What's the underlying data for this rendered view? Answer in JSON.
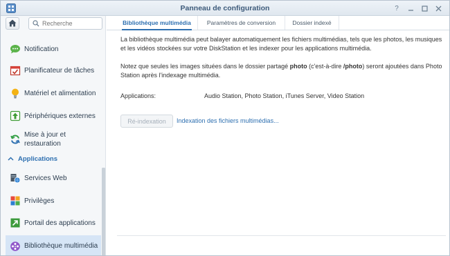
{
  "window": {
    "title": "Panneau de configuration"
  },
  "search": {
    "placeholder": "Recherche"
  },
  "sidebar": {
    "items": [
      {
        "label": "Notification"
      },
      {
        "label": "Planificateur de tâches"
      },
      {
        "label": "Matériel et alimentation"
      },
      {
        "label": "Périphériques externes"
      },
      {
        "label": "Mise à jour et restauration"
      },
      {
        "label": "Services Web"
      },
      {
        "label": "Privilèges"
      },
      {
        "label": "Portail des applications"
      },
      {
        "label": "Bibliothèque multimédia"
      }
    ],
    "section_label": "Applications",
    "active_item": "Bibliothèque multimédia"
  },
  "tabs": [
    {
      "label": "Bibliothèque multimédia"
    },
    {
      "label": "Paramètres de conversion"
    },
    {
      "label": "Dossier indexé"
    }
  ],
  "main": {
    "intro": "La bibliothèque multimédia peut balayer automatiquement les fichiers multimédias, tels que les photos, les musiques et les vidéos stockées sur votre DiskStation et les indexer pour les applications multimédia.",
    "note_before": "Notez que seules les images situées dans le dossier partagé ",
    "note_folder": "photo",
    "note_mid": " (c'est-à-dire ",
    "note_path": "/photo",
    "note_after": ") seront ajoutées dans Photo Station après l'indexage multimédia.",
    "applications_label": "Applications:",
    "applications_value": "Audio Station, Photo Station, iTunes Server, Video Station",
    "reindex_button": "Ré-indexation",
    "indexing_link": "Indexation des fichiers multimédias..."
  },
  "colors": {
    "accent": "#2d6fb0",
    "active_bg": "#d6e5f6",
    "sidebar_bg": "#f5f7f9"
  }
}
